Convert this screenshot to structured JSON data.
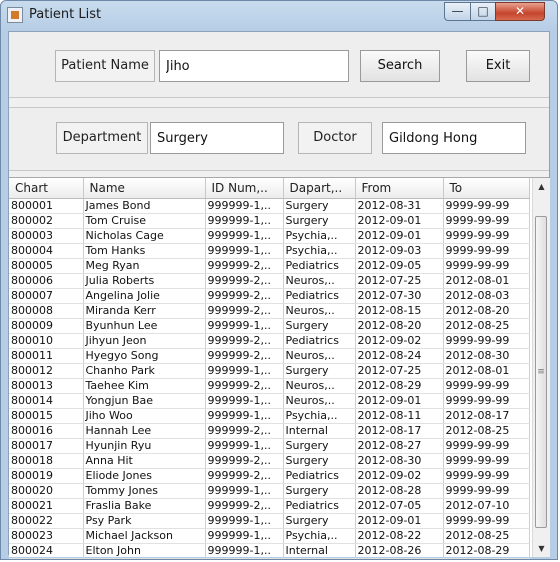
{
  "window": {
    "title": "Patient List",
    "min_icon": "minimize-icon",
    "max_icon": "maximize-icon",
    "close_icon": "close-icon",
    "app_icon": "java-cup-icon"
  },
  "search": {
    "patient_name_label": "Patient Name",
    "patient_name_value": "Jiho",
    "search_label": "Search",
    "exit_label": "Exit"
  },
  "detail": {
    "department_label": "Department",
    "department_value": "Surgery",
    "doctor_label": "Doctor",
    "doctor_value": "Gildong Hong"
  },
  "table": {
    "columns": [
      "Chart",
      "Name",
      "ID Num,..",
      "Dapart,..",
      "From",
      "To"
    ],
    "rows": [
      [
        "800001",
        "James Bond",
        "999999-1,..",
        "Surgery",
        "2012-08-31",
        "9999-99-99"
      ],
      [
        "800002",
        "Tom Cruise",
        "999999-1,..",
        "Surgery",
        "2012-09-01",
        "9999-99-99"
      ],
      [
        "800003",
        "Nicholas Cage",
        "999999-1,..",
        "Psychia,..",
        "2012-09-01",
        "9999-99-99"
      ],
      [
        "800004",
        "Tom Hanks",
        "999999-1,..",
        "Psychia,..",
        "2012-09-03",
        "9999-99-99"
      ],
      [
        "800005",
        "Meg Ryan",
        "999999-2,..",
        "Pediatrics",
        "2012-09-05",
        "9999-99-99"
      ],
      [
        "800006",
        "Julia Roberts",
        "999999-2,..",
        "Neuros,..",
        "2012-07-25",
        "2012-08-01"
      ],
      [
        "800007",
        "Angelina Jolie",
        "999999-2,..",
        "Pediatrics",
        "2012-07-30",
        "2012-08-03"
      ],
      [
        "800008",
        "Miranda Kerr",
        "999999-2,..",
        "Neuros,..",
        "2012-08-15",
        "2012-08-20"
      ],
      [
        "800009",
        "Byunhun Lee",
        "999999-1,..",
        "Surgery",
        "2012-08-20",
        "2012-08-25"
      ],
      [
        "800010",
        "Jihyun Jeon",
        "999999-2,..",
        "Pediatrics",
        "2012-09-02",
        "9999-99-99"
      ],
      [
        "800011",
        "Hyegyo Song",
        "999999-2,..",
        "Neuros,..",
        "2012-08-24",
        "2012-08-30"
      ],
      [
        "800012",
        "Chanho Park",
        "999999-1,..",
        "Surgery",
        "2012-07-25",
        "2012-08-01"
      ],
      [
        "800013",
        "Taehee Kim",
        "999999-2,..",
        "Neuros,..",
        "2012-08-29",
        "9999-99-99"
      ],
      [
        "800014",
        "Yongjun Bae",
        "999999-1,..",
        "Neuros,..",
        "2012-09-01",
        "9999-99-99"
      ],
      [
        "800015",
        "Jiho Woo",
        "999999-1,..",
        "Psychia,..",
        "2012-08-11",
        "2012-08-17"
      ],
      [
        "800016",
        "Hannah Lee",
        "999999-2,..",
        "Internal",
        "2012-08-17",
        "2012-08-25"
      ],
      [
        "800017",
        "Hyunjin Ryu",
        "999999-1,..",
        "Surgery",
        "2012-08-27",
        "9999-99-99"
      ],
      [
        "800018",
        "Anna Hit",
        "999999-2,..",
        "Surgery",
        "2012-08-30",
        "9999-99-99"
      ],
      [
        "800019",
        "Eliode Jones",
        "999999-2,..",
        "Pediatrics",
        "2012-09-02",
        "9999-99-99"
      ],
      [
        "800020",
        "Tommy Jones",
        "999999-1,..",
        "Surgery",
        "2012-08-28",
        "9999-99-99"
      ],
      [
        "800021",
        "Fraslia Bake",
        "999999-2,..",
        "Pediatrics",
        "2012-07-05",
        "2012-07-10"
      ],
      [
        "800022",
        "Psy Park",
        "999999-1,..",
        "Surgery",
        "2012-09-01",
        "9999-99-99"
      ],
      [
        "800023",
        "Michael Jackson",
        "999999-1,..",
        "Psychia,..",
        "2012-08-22",
        "2012-08-25"
      ],
      [
        "800024",
        "Elton John",
        "999999-1,..",
        "Internal",
        "2012-08-26",
        "2012-08-29"
      ]
    ]
  },
  "scrollbar": {
    "up_icon": "scroll-up-arrow-icon",
    "down_icon": "scroll-down-arrow-icon",
    "grip": "≡"
  }
}
